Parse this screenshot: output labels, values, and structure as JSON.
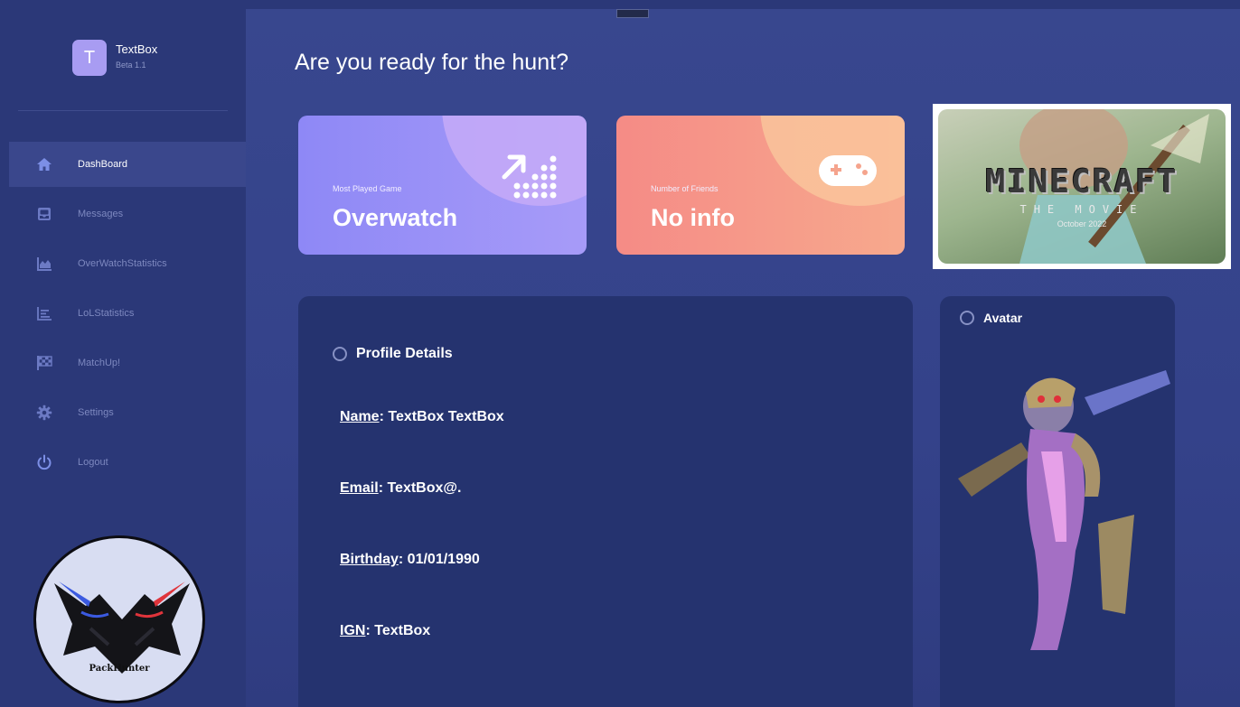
{
  "brand": {
    "logo_letter": "T",
    "name": "TextBox",
    "version": "Beta 1.1"
  },
  "sidebar": {
    "items": [
      {
        "label": "DashBoard",
        "icon": "home-icon",
        "active": true
      },
      {
        "label": "Messages",
        "icon": "inbox-icon",
        "active": false
      },
      {
        "label": "OverWatchStatistics",
        "icon": "area-chart-icon",
        "active": false
      },
      {
        "label": "LoLStatistics",
        "icon": "bar-list-icon",
        "active": false
      },
      {
        "label": "MatchUp!",
        "icon": "checkered-flag-icon",
        "active": false
      },
      {
        "label": "Settings",
        "icon": "gear-icon",
        "active": false
      },
      {
        "label": "Logout",
        "icon": "power-icon",
        "active": false
      }
    ],
    "team_logo_text": "PackHunter"
  },
  "main": {
    "heading": "Are you ready for the hunt?",
    "cards": [
      {
        "label": "Most Played Game",
        "value": "Overwatch",
        "icon": "trend-dots-icon",
        "color": "#8e88f6"
      },
      {
        "label": "Number of Friends",
        "value": "No info",
        "icon": "gamepad-icon",
        "color": "#f58b86"
      }
    ],
    "promo": {
      "title": "MINECRAFT",
      "subtitle": "THE MOVIE",
      "date": "October 2022"
    },
    "profile": {
      "title": "Profile Details",
      "fields": [
        {
          "key": "Name",
          "value": ": TextBox TextBox"
        },
        {
          "key": "Email",
          "value": ": TextBox@."
        },
        {
          "key": "Birthday",
          "value": ": 01/01/1990"
        },
        {
          "key": "IGN",
          "value": ": TextBox"
        }
      ]
    },
    "avatar": {
      "title": "Avatar"
    }
  },
  "colors": {
    "background": "#34428a",
    "sidebar": "#2b3878",
    "panel": "#25336f",
    "accent_purple": "#a89cf2",
    "accent_orange": "#f7a98d"
  }
}
